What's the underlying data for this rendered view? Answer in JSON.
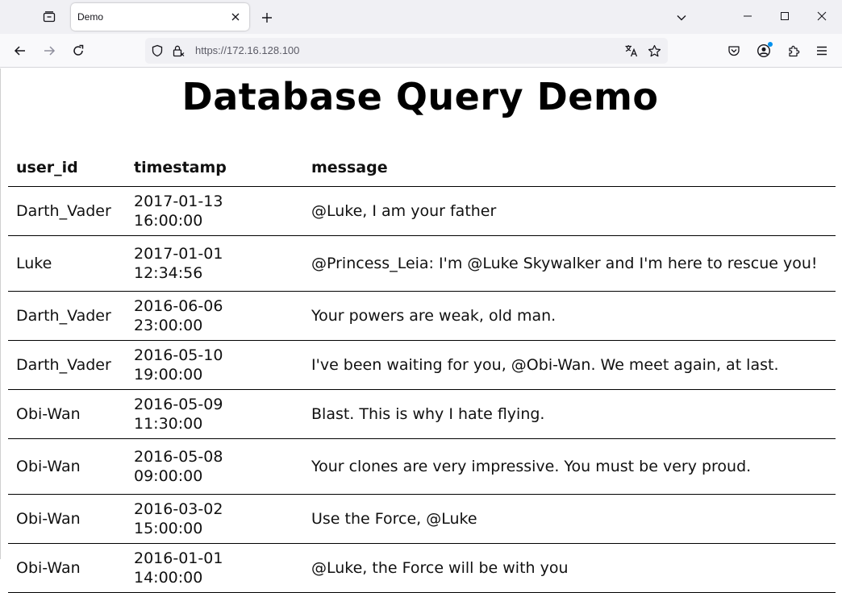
{
  "browser": {
    "tab_title": "Demo",
    "url": "https://172.16.128.100"
  },
  "page": {
    "title": "Database Query Demo",
    "table": {
      "headers": [
        "user_id",
        "timestamp",
        "message"
      ],
      "rows": [
        {
          "user_id": "Darth_Vader",
          "timestamp": "2017-01-13 16:00:00",
          "message": "@Luke, I am your father"
        },
        {
          "user_id": "Luke",
          "timestamp": "2017-01-01 12:34:56",
          "message": "@Princess_Leia: I'm @Luke Skywalker and I'm here to rescue you!"
        },
        {
          "user_id": "Darth_Vader",
          "timestamp": "2016-06-06 23:00:00",
          "message": "Your powers are weak, old man."
        },
        {
          "user_id": "Darth_Vader",
          "timestamp": "2016-05-10 19:00:00",
          "message": "I've been waiting for you, @Obi-Wan. We meet again, at last."
        },
        {
          "user_id": "Obi-Wan",
          "timestamp": "2016-05-09 11:30:00",
          "message": "Blast. This is why I hate flying."
        },
        {
          "user_id": "Obi-Wan",
          "timestamp": "2016-05-08 09:00:00",
          "message": "Your clones are very impressive. You must be very proud."
        },
        {
          "user_id": "Obi-Wan",
          "timestamp": "2016-03-02 15:00:00",
          "message": "Use the Force, @Luke"
        },
        {
          "user_id": "Obi-Wan",
          "timestamp": "2016-01-01 14:00:00",
          "message": "@Luke, the Force will be with you"
        }
      ]
    }
  },
  "icons": {
    "tab_overview": "tab-overview-icon",
    "close_tab": "close-icon",
    "new_tab": "plus-icon",
    "list_tabs": "chevron-down-icon",
    "minimize": "minimize-icon",
    "maximize": "maximize-icon",
    "close_window": "close-icon",
    "back": "back-arrow-icon",
    "forward": "forward-arrow-icon",
    "reload": "reload-icon",
    "shield": "shield-icon",
    "lock": "lock-icon",
    "translate": "translate-icon",
    "bookmark": "star-icon",
    "pocket": "pocket-icon",
    "account": "account-icon",
    "extensions": "puzzle-icon",
    "menu": "hamburger-menu-icon"
  },
  "colors": {
    "chrome_bg": "#f0f0f4",
    "notification_dot": "#0090ed"
  }
}
